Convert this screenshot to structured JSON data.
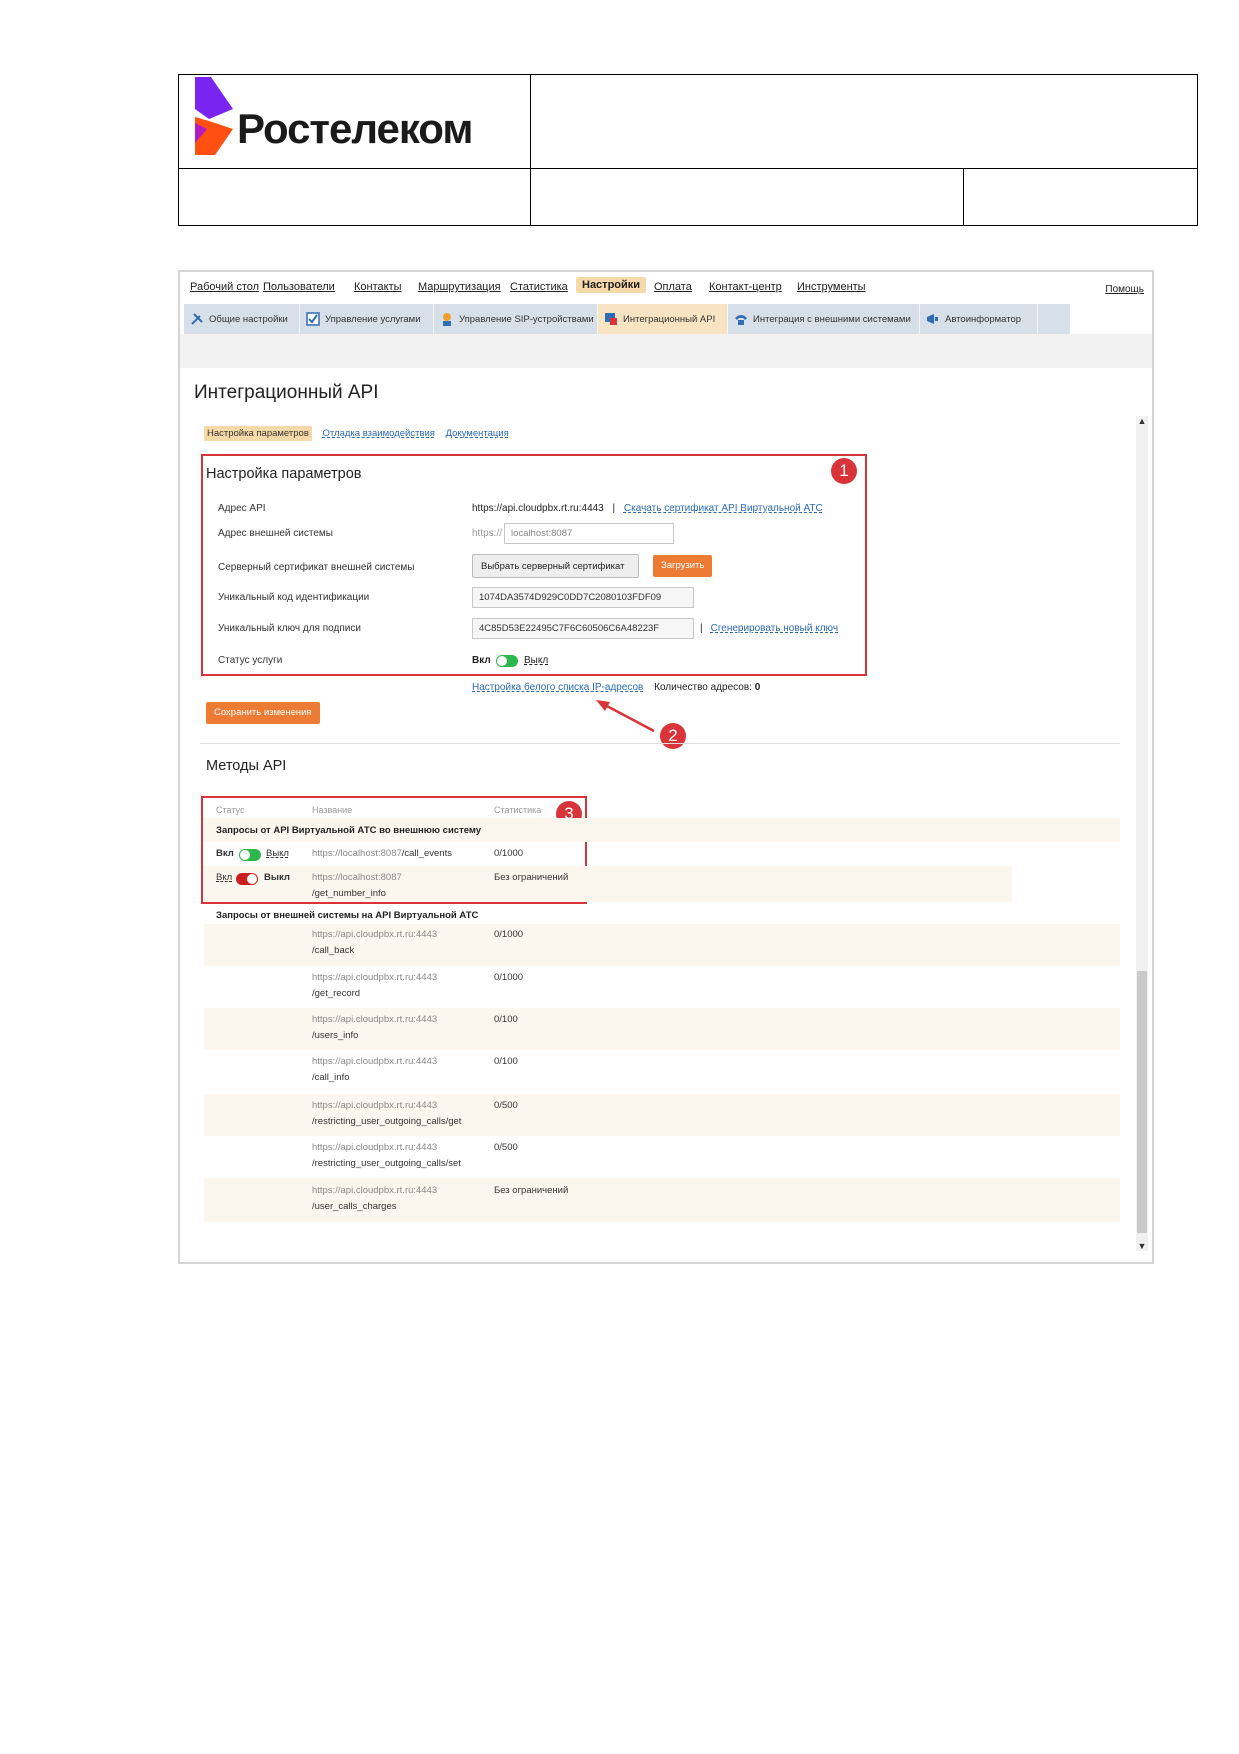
{
  "doc": {
    "brand": "Ростелеком",
    "brand_colors": [
      "#7a24f0",
      "#ff4f12"
    ]
  },
  "topnav": {
    "items": [
      "Рабочий стол",
      "Пользователи",
      "Контакты",
      "Маршрутизация",
      "Статистика",
      "Настройки",
      "Оплата",
      "Контакт-центр",
      "Инструменты"
    ],
    "active": "Настройки",
    "help": "Помощь"
  },
  "subnav": {
    "tabs": [
      {
        "label": "Общие настройки",
        "icon": "tools-icon"
      },
      {
        "label": "Управление услугами",
        "icon": "checkbox-icon"
      },
      {
        "label": "Управление SIP-устройствами",
        "icon": "sip-device-icon"
      },
      {
        "label": "Интеграционный API",
        "icon": "api-icon"
      },
      {
        "label": "Интеграция с внешними системами",
        "icon": "phone-icon"
      },
      {
        "label": "Автоинформатор",
        "icon": "megaphone-icon"
      }
    ],
    "active": "Интеграционный API"
  },
  "page_title": "Интеграционный API",
  "inner_tabs": [
    "Настройка параметров",
    "Отладка взаимодействия",
    "Документация"
  ],
  "settings": {
    "title": "Настройка параметров",
    "api_address_label": "Адрес API",
    "api_address_value": "https://api.cloudpbx.rt.ru:4443",
    "download_cert_link": "Скачать сертификат API Виртуальной АТС",
    "ext_address_label": "Адрес внешней системы",
    "ext_address_prefix": "https://",
    "ext_address_value": "localhost:8087",
    "server_cert_label": "Серверный сертификат внешней системы",
    "choose_cert_button": "Выбрать серверный сертификат",
    "upload_button": "Загрузить",
    "unique_code_label": "Уникальный код идентификации",
    "unique_code_value": "1074DA3574D929C0DD7C2080103FDF09",
    "unique_key_label": "Уникальный ключ для подписи",
    "unique_key_value": "4C85D53E22495C7F6C60506C6A48223F",
    "generate_key_link": "Сгенерировать новый ключ",
    "service_status_label": "Статус услуги",
    "status_on": "Вкл",
    "status_off": "Выкл",
    "whitelist_link": "Настройка белого списка IP-адресов",
    "address_count_label": "Количество адресов:",
    "address_count_value": "0",
    "save_button": "Сохранить изменения"
  },
  "badges": [
    "1",
    "2",
    "3"
  ],
  "methods": {
    "title": "Методы API",
    "headers": [
      "Статус",
      "Название",
      "Статистика"
    ],
    "group1_title": "Запросы от API Виртуальной АТС во внешнюю систему",
    "group1_rows": [
      {
        "on": "Вкл",
        "off": "Выкл",
        "state": "on",
        "host": "https://localhost:8087",
        "path": "/call_events",
        "stat": "0/1000"
      },
      {
        "on": "Вкл",
        "off": "Выкл",
        "state": "off",
        "host": "https://localhost:8087",
        "path": "/get_number_info",
        "stat": "Без ограничений"
      }
    ],
    "group2_title": "Запросы от внешней системы на API Виртуальной АТС",
    "group2_rows": [
      {
        "host": "https://api.cloudpbx.rt.ru:4443",
        "path": "/call_back",
        "stat": "0/1000"
      },
      {
        "host": "https://api.cloudpbx.rt.ru:4443",
        "path": "/get_record",
        "stat": "0/1000"
      },
      {
        "host": "https://api.cloudpbx.rt.ru:4443",
        "path": "/users_info",
        "stat": "0/100"
      },
      {
        "host": "https://api.cloudpbx.rt.ru:4443",
        "path": "/call_info",
        "stat": "0/100"
      },
      {
        "host": "https://api.cloudpbx.rt.ru:4443",
        "path": "/restricting_user_outgoing_calls/get",
        "stat": "0/500"
      },
      {
        "host": "https://api.cloudpbx.rt.ru:4443",
        "path": "/restricting_user_outgoing_calls/set",
        "stat": "0/500"
      },
      {
        "host": "https://api.cloudpbx.rt.ru:4443",
        "path": "/user_calls_charges",
        "stat": "Без ограничений"
      }
    ]
  },
  "colors": {
    "annotation_red": "#d9343a",
    "accent_orange": "#ee7b34",
    "toggle_on": "#2db84b",
    "toggle_off": "#cc1e1e",
    "active_tab": "#f6d9a8"
  }
}
